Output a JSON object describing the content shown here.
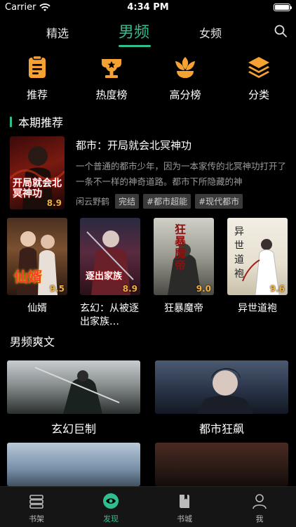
{
  "status": {
    "carrier": "Carrier",
    "time": "4:34 PM"
  },
  "top_tabs": {
    "featured": "精选",
    "male": "男频",
    "female": "女频"
  },
  "categories": [
    {
      "label": "推荐",
      "icon": "recommend-icon"
    },
    {
      "label": "热度榜",
      "icon": "trophy-icon"
    },
    {
      "label": "高分榜",
      "icon": "flower-icon"
    },
    {
      "label": "分类",
      "icon": "layers-icon"
    }
  ],
  "section_current": "本期推荐",
  "featured": {
    "title": "都市：开局就会北冥神功",
    "description": "一个普通的都市少年，因为一本家传的北冥神功打开了一条不一样的神奇道路。都市下所隐藏的神",
    "author": "闲云野鹤",
    "status": "完结",
    "tags": [
      "#都市超能",
      "#现代都市"
    ],
    "score": "8.9",
    "cover_text": "开局就会北冥神功"
  },
  "books": [
    {
      "title": "仙婿",
      "score": "9.5",
      "cover_text": "仙婿"
    },
    {
      "title": "玄幻：从被逐出家族…",
      "score": "8.9",
      "cover_text": "逐出家族"
    },
    {
      "title": "狂暴魔帝",
      "score": "9.0",
      "cover_text": "狂暴魔帝"
    },
    {
      "title": "异世道袍",
      "score": "9.6",
      "cover_text": "异世道袍"
    }
  ],
  "section_male": "男频爽文",
  "wide_cards": [
    {
      "title": "玄幻巨制"
    },
    {
      "title": "都市狂飙"
    }
  ],
  "tabbar": [
    {
      "label": "书架",
      "icon": "bookshelf-icon"
    },
    {
      "label": "发现",
      "icon": "eye-icon"
    },
    {
      "label": "书城",
      "icon": "book-icon"
    },
    {
      "label": "我",
      "icon": "user-icon"
    }
  ],
  "colors": {
    "accent": "#2fbf8f",
    "icon_orange": "#f5a233",
    "score": "#f0b040"
  }
}
